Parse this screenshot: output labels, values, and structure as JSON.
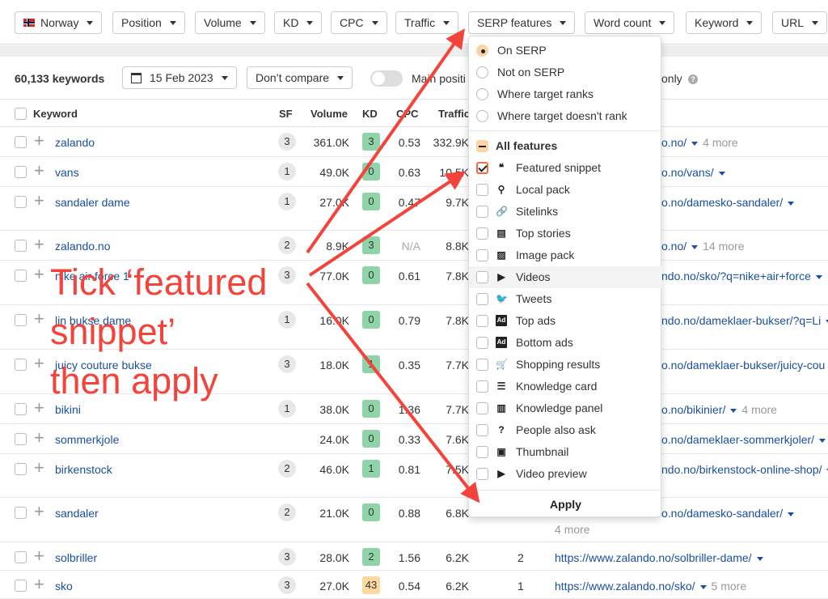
{
  "filters": [
    {
      "label": "Norway",
      "icon": "norway-flag-icon"
    },
    {
      "label": "Position"
    },
    {
      "label": "Volume"
    },
    {
      "label": "KD"
    },
    {
      "label": "CPC"
    },
    {
      "label": "Traffic"
    },
    {
      "label": "SERP features"
    },
    {
      "label": "Word count"
    },
    {
      "label": "Keyword"
    },
    {
      "label": "URL"
    }
  ],
  "toolbar": {
    "keyword_count": "60,133 keywords",
    "date": "15 Feb 2023",
    "compare": "Don’t compare",
    "main_positions_label": "Main positi",
    "only_label": "only",
    "help_icon": "?"
  },
  "table": {
    "headers": {
      "keyword": "Keyword",
      "sf": "SF",
      "volume": "Volume",
      "kd": "KD",
      "cpc": "CPC",
      "traffic": "Traffic"
    },
    "rows": [
      {
        "keyword": "zalando",
        "sf": "3",
        "volume": "361.0K",
        "kd": "3",
        "cpc": "0.53",
        "traffic": "332.9K",
        "url_tail": "o.no/",
        "more": "4 more"
      },
      {
        "keyword": "vans",
        "sf": "1",
        "volume": "49.0K",
        "kd": "0",
        "cpc": "0.63",
        "traffic": "10.5K",
        "url_tail": "o.no/vans/",
        "more": ""
      },
      {
        "keyword": "sandaler dame",
        "sf": "1",
        "volume": "27.0K",
        "kd": "0",
        "cpc": "0.47",
        "traffic": "9.7K",
        "url_tail": "o.no/damesko-sandaler/",
        "more": ""
      },
      {
        "keyword": "zalando.no",
        "sf": "2",
        "volume": "8.9K",
        "kd": "3",
        "cpc": "N/A",
        "traffic": "8.8K",
        "url_tail": "o.no/",
        "more": "14 more"
      },
      {
        "keyword": "nike air force 1",
        "sf": "3",
        "volume": "77.0K",
        "kd": "0",
        "cpc": "0.61",
        "traffic": "7.8K",
        "url_tail": "ndo.no/sko/?q=nike+air+force",
        "more": ""
      },
      {
        "keyword": "lin bukse dame",
        "sf": "1",
        "volume": "16.0K",
        "kd": "0",
        "cpc": "0.79",
        "traffic": "7.8K",
        "url_tail": "ndo.no/dameklaer-bukser/?q=Li",
        "more": ""
      },
      {
        "keyword": "juicy couture bukse",
        "sf": "3",
        "volume": "18.0K",
        "kd": "1",
        "cpc": "0.35",
        "traffic": "7.7K",
        "url_tail": "o.no/dameklaer-bukser/juicy-cou",
        "more": ""
      },
      {
        "keyword": "bikini",
        "sf": "1",
        "volume": "38.0K",
        "kd": "0",
        "cpc": "1.36",
        "traffic": "7.7K",
        "url_tail": "o.no/bikinier/",
        "more": "4 more"
      },
      {
        "keyword": "sommerkjole",
        "sf": "",
        "volume": "24.0K",
        "kd": "0",
        "cpc": "0.33",
        "traffic": "7.6K",
        "url_tail": "o.no/dameklaer-sommerkjoler/",
        "more": ""
      },
      {
        "keyword": "birkenstock",
        "sf": "2",
        "volume": "46.0K",
        "kd": "1",
        "cpc": "0.81",
        "traffic": "7.5K",
        "url_tail": "ndo.no/birkenstock-online-shop/",
        "more": ""
      },
      {
        "keyword": "sandaler",
        "sf": "2",
        "volume": "21.0K",
        "kd": "0",
        "cpc": "0.88",
        "traffic": "6.8K",
        "url_tail": "o.no/damesko-sandaler/",
        "more": "4 more"
      },
      {
        "keyword": "solbriller",
        "sf": "3",
        "volume": "28.0K",
        "kd": "2",
        "cpc": "1.56",
        "traffic": "6.2K",
        "position": "2",
        "url": "https://www.zalando.no/solbriller-dame/",
        "more": ""
      },
      {
        "keyword": "sko",
        "sf": "3",
        "volume": "27.0K",
        "kd": "43",
        "cpc": "0.54",
        "traffic": "6.2K",
        "position": "1",
        "url": "https://www.zalando.no/sko/",
        "more": "5 more"
      }
    ]
  },
  "dropdown": {
    "radios": [
      {
        "label": "On SERP",
        "selected": true
      },
      {
        "label": "Not on SERP",
        "selected": false
      },
      {
        "label": "Where target ranks",
        "selected": false
      },
      {
        "label": "Where target doesn't rank",
        "selected": false
      }
    ],
    "all_features_label": "All features",
    "features": [
      {
        "label": "Featured snippet",
        "icon": "quote-icon",
        "glyph": "❝",
        "checked": true
      },
      {
        "label": "Local pack",
        "icon": "map-pin-icon",
        "glyph": "⚲",
        "checked": false
      },
      {
        "label": "Sitelinks",
        "icon": "link-icon",
        "glyph": "🔗",
        "checked": false
      },
      {
        "label": "Top stories",
        "icon": "newspaper-icon",
        "glyph": "▤",
        "checked": false
      },
      {
        "label": "Image pack",
        "icon": "image-pack-icon",
        "glyph": "▨",
        "checked": false
      },
      {
        "label": "Videos",
        "icon": "video-icon",
        "glyph": "▶",
        "checked": false
      },
      {
        "label": "Tweets",
        "icon": "twitter-icon",
        "glyph": "🐦",
        "checked": false
      },
      {
        "label": "Top ads",
        "icon": "ad-top-icon",
        "glyph": "Ad",
        "checked": false
      },
      {
        "label": "Bottom ads",
        "icon": "ad-bottom-icon",
        "glyph": "Ad",
        "checked": false
      },
      {
        "label": "Shopping results",
        "icon": "cart-icon",
        "glyph": "🛒",
        "checked": false
      },
      {
        "label": "Knowledge card",
        "icon": "knowledge-card-icon",
        "glyph": "☰",
        "checked": false
      },
      {
        "label": "Knowledge panel",
        "icon": "knowledge-panel-icon",
        "glyph": "▥",
        "checked": false
      },
      {
        "label": "People also ask",
        "icon": "question-bubble-icon",
        "glyph": "?",
        "checked": false
      },
      {
        "label": "Thumbnail",
        "icon": "thumbnail-icon",
        "glyph": "▣",
        "checked": false
      },
      {
        "label": "Video preview",
        "icon": "video-preview-icon",
        "glyph": "▶",
        "checked": false
      }
    ],
    "hovered_feature": "Videos",
    "apply_label": "Apply"
  },
  "annotation": {
    "line1": "Tick ‘featured",
    "line2": "snippet’",
    "line3": "then apply",
    "color": "#f4433a"
  }
}
